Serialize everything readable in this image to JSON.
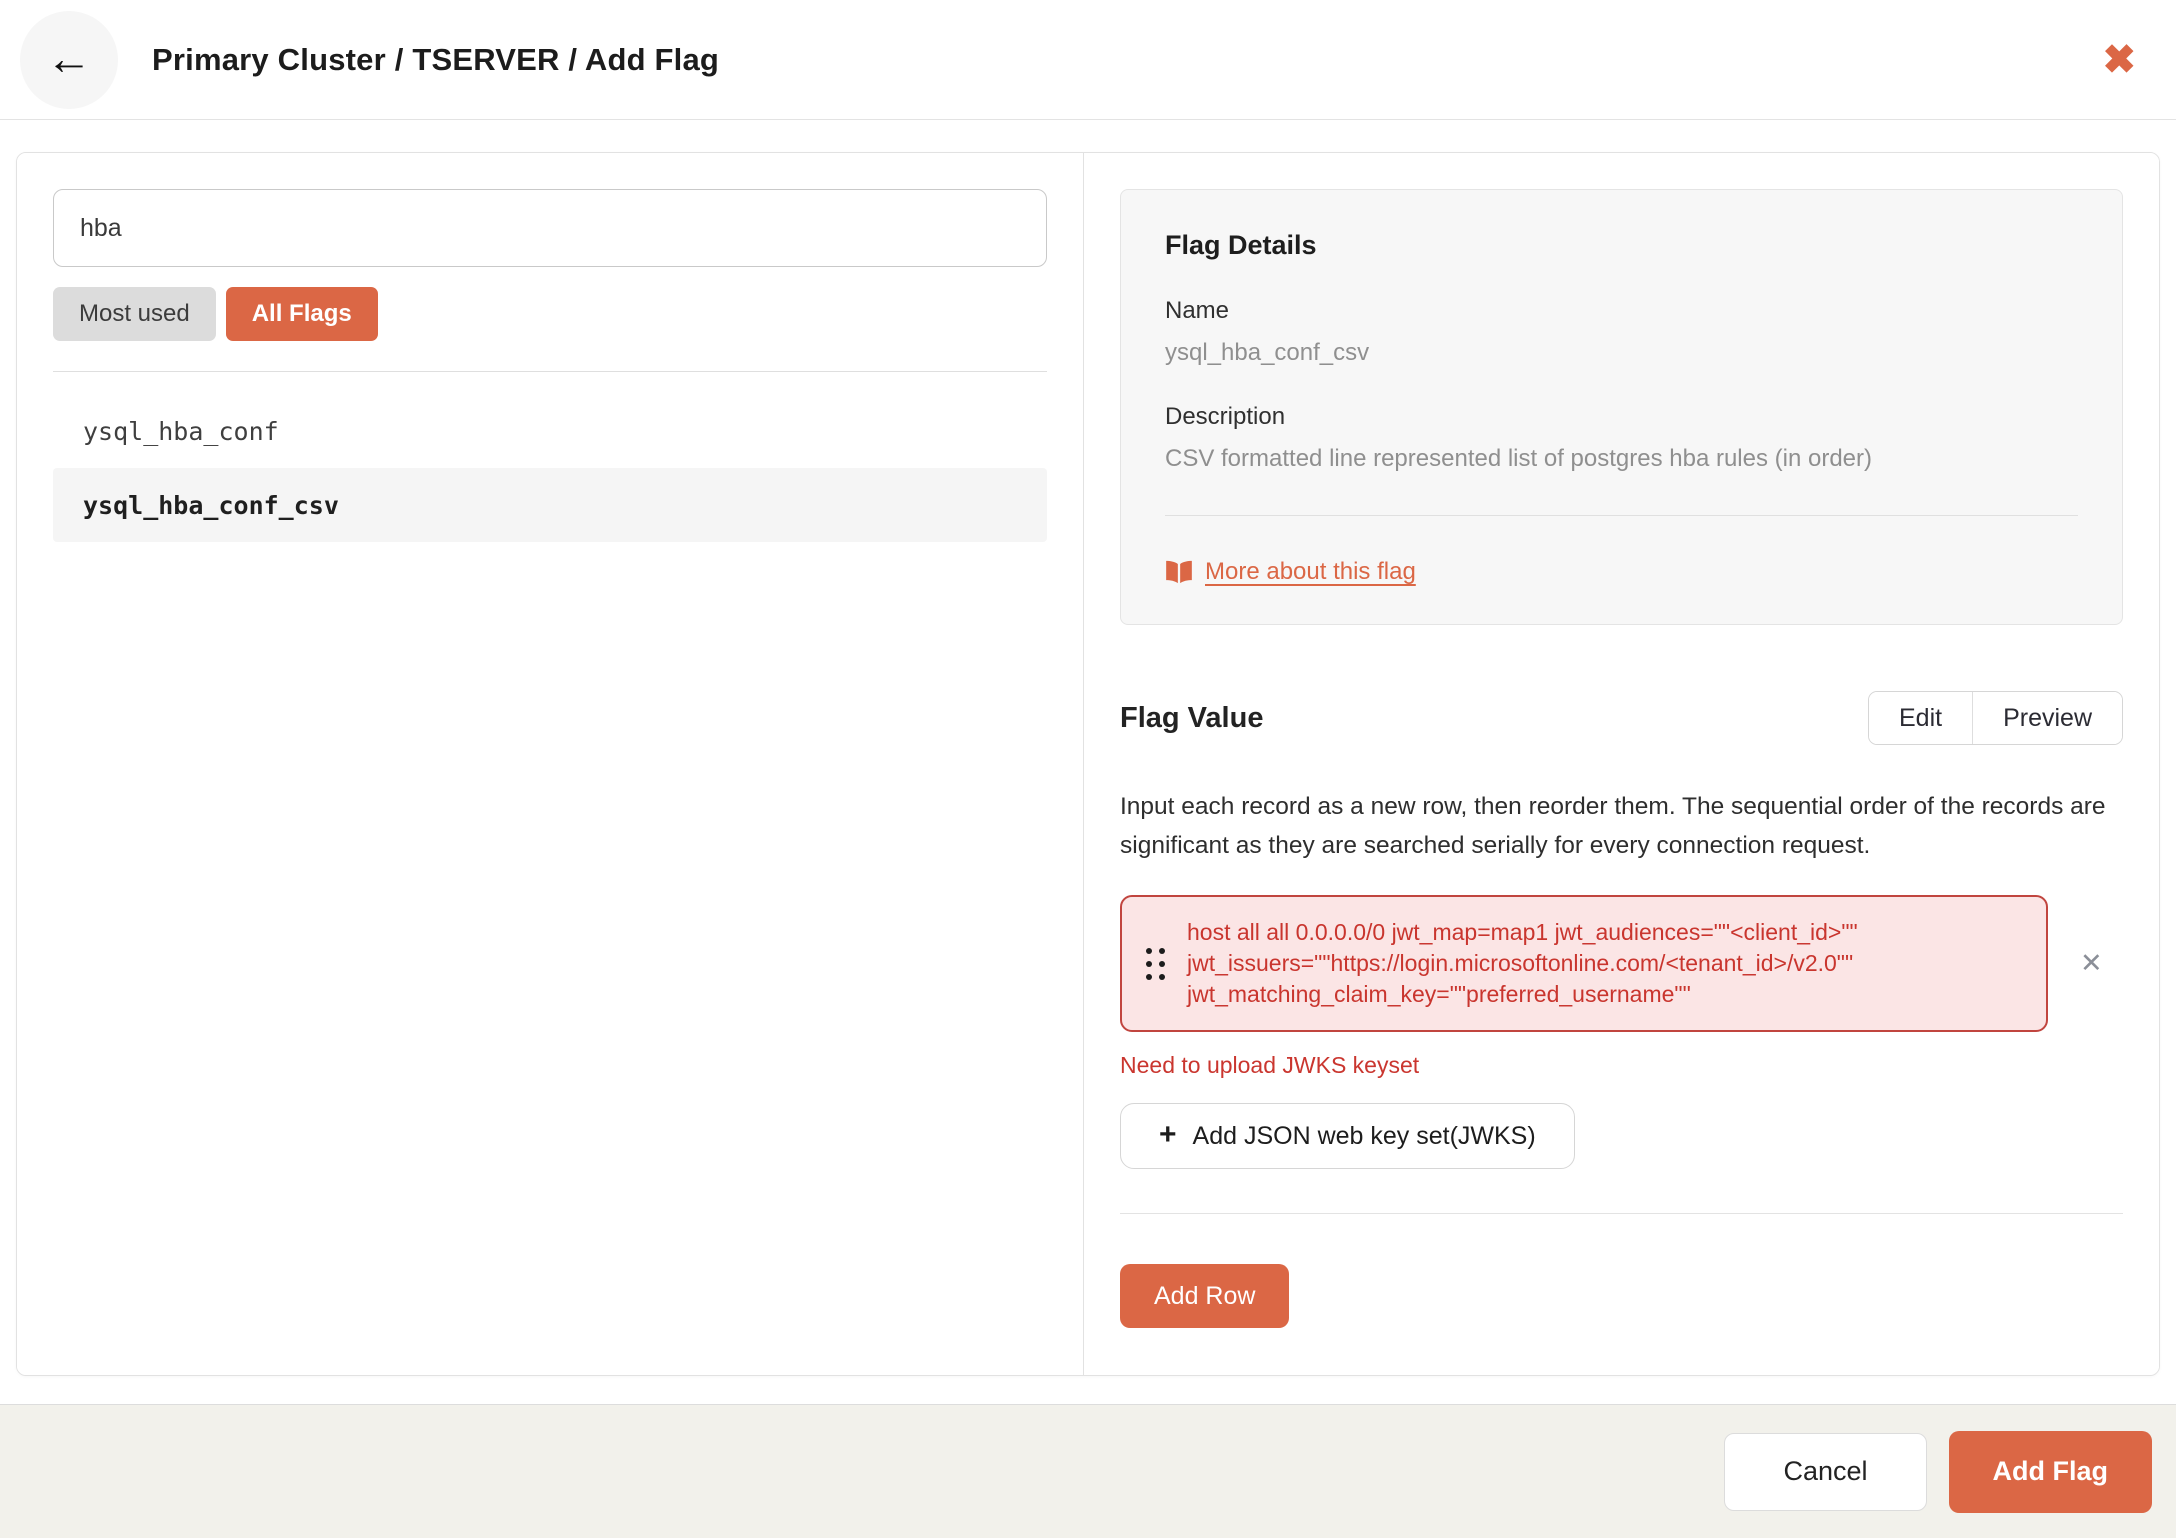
{
  "accent_color": "#DB6745",
  "error_color": "#C9352E",
  "header": {
    "title": "Primary Cluster / TSERVER / Add Flag"
  },
  "icons": {
    "back": "←",
    "close": "✖",
    "plus": "+",
    "remove": "✕",
    "book": "open-book-icon",
    "drag": "drag-dots-icon"
  },
  "left_panel": {
    "search_value": "hba",
    "filters": [
      {
        "label": "Most used",
        "active": false
      },
      {
        "label": "All Flags",
        "active": true
      }
    ],
    "flags": [
      {
        "name": "ysql_hba_conf",
        "selected": false
      },
      {
        "name": "ysql_hba_conf_csv",
        "selected": true
      }
    ]
  },
  "flag_details": {
    "title": "Flag Details",
    "name_label": "Name",
    "name_value": "ysql_hba_conf_csv",
    "description_label": "Description",
    "description_value": "CSV formatted line represented list of postgres hba rules (in order)",
    "more_link": "More about this flag"
  },
  "flag_value": {
    "title": "Flag Value",
    "edit_label": "Edit",
    "preview_label": "Preview",
    "instructions": "Input each record as a new row, then reorder them. The sequential order of the records are significant as they are searched serially for every connection request.",
    "row_value": "host all all 0.0.0.0/0 jwt_map=map1 jwt_audiences=\"\"<client_id>\"\" jwt_issuers=\"\"https://login.microsoftonline.com/<tenant_id>/v2.0\"\" jwt_matching_claim_key=\"\"preferred_username\"\"",
    "row_error": "Need to upload JWKS keyset",
    "jwks_button": "Add JSON web key set(JWKS)",
    "add_row_button": "Add Row"
  },
  "footer": {
    "cancel_label": "Cancel",
    "add_flag_label": "Add Flag"
  }
}
